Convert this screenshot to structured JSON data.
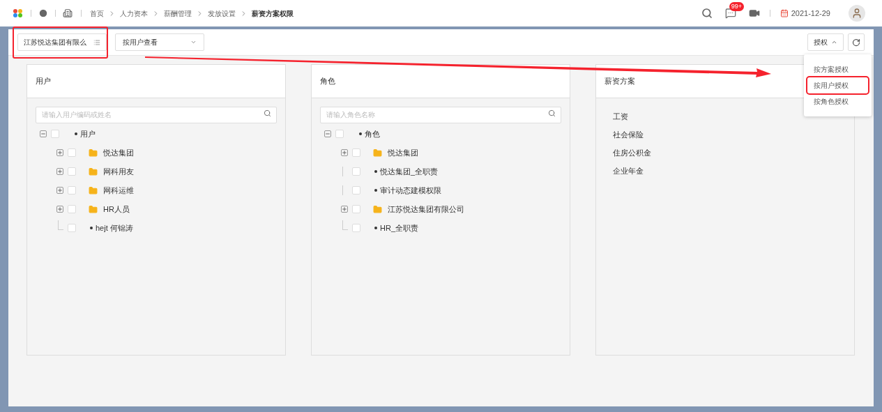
{
  "breadcrumb": [
    {
      "label": "首页",
      "current": false
    },
    {
      "label": "人力资本",
      "current": false
    },
    {
      "label": "薪酬管理",
      "current": false
    },
    {
      "label": "发放设置",
      "current": false
    },
    {
      "label": "薪资方案权限",
      "current": true
    }
  ],
  "header": {
    "badge": "99+",
    "date": "2021-12-29"
  },
  "toolbar": {
    "org_select": "江苏悦达集团有限么",
    "view_select": "按用户查看",
    "auth_button": "授权",
    "auth_menu": [
      {
        "label": "按方案授权",
        "selected": false
      },
      {
        "label": "按用户授权",
        "selected": true
      },
      {
        "label": "按角色授权",
        "selected": false
      }
    ]
  },
  "panels": [
    {
      "title": "用户",
      "placeholder": "请输入用户编码或姓名",
      "tree": [
        {
          "label": "用户",
          "kind": "root",
          "expanded": true,
          "checked": false,
          "children": [
            {
              "label": "悦达集团",
              "kind": "folder",
              "expanded": false,
              "checked": false
            },
            {
              "label": "网科用友",
              "kind": "folder",
              "expanded": false,
              "checked": false
            },
            {
              "label": "网科运维",
              "kind": "folder",
              "expanded": false,
              "checked": false
            },
            {
              "label": "HR人员",
              "kind": "folder",
              "expanded": false,
              "checked": false
            },
            {
              "label": "hejt 何锦涛",
              "kind": "leaf",
              "checked": false
            }
          ]
        }
      ]
    },
    {
      "title": "角色",
      "placeholder": "请输入角色名称",
      "tree": [
        {
          "label": "角色",
          "kind": "root",
          "expanded": true,
          "checked": false,
          "children": [
            {
              "label": "悦达集团",
              "kind": "folder",
              "expanded": false,
              "checked": false
            },
            {
              "label": "悦达集团_全职责",
              "kind": "leaf",
              "checked": false
            },
            {
              "label": "审计动态建模权限",
              "kind": "leaf",
              "checked": false
            },
            {
              "label": "江苏悦达集团有限公司",
              "kind": "folder",
              "expanded": false,
              "checked": false
            },
            {
              "label": "HR_全职责",
              "kind": "leaf",
              "checked": false
            }
          ]
        }
      ]
    },
    {
      "title": "薪资方案",
      "items": [
        "工资",
        "社会保险",
        "住房公积金",
        "企业年金"
      ]
    }
  ]
}
